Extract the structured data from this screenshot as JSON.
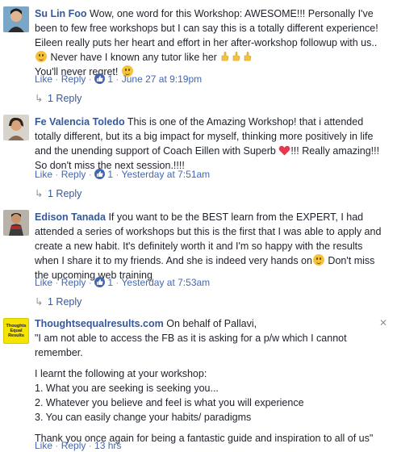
{
  "comments": [
    {
      "author": "Su Lin Foo",
      "text_1": " Wow, one word for this Workshop: AWESOME!!! Personally I've been to few free workshops but I can say this is a totally different experience! Eileen really puts her heart and effort in her after-workshop followup with us..",
      "text_2": " Never have I known any tutor like her",
      "text_3": "You'll never regret!",
      "like": "Like",
      "reply": "Reply",
      "like_count": "1",
      "time": "June 27 at 9:19pm",
      "replies": "1 Reply"
    },
    {
      "author": "Fe Valencia Toledo",
      "text_1": " This is one of the Amazing Workshop! that i attended totally different, but its a big impact for myself, thinking more positively in life and the unending support of Coach Eillen with Superb",
      "text_2": "!!! Really amazing!!! So don't miss the next session.!!!!",
      "like": "Like",
      "reply": "Reply",
      "like_count": "1",
      "time": "Yesterday at 7:51am",
      "replies": "1 Reply"
    },
    {
      "author": "Edison Tanada",
      "text_1": " If you want to be the BEST learn from the EXPERT, I had attended a series of workshops but this is the first that I was able to apply and create a new habit. It's definitely worth it and I'm so happy with the results when I share it to my friends. And she is indeed very hands on",
      "text_2": " Don't miss the upcoming web training",
      "like": "Like",
      "reply": "Reply",
      "like_count": "1",
      "time": "Yesterday at 7:53am",
      "replies": "1 Reply"
    },
    {
      "author": "Thoughtsequalresults.com",
      "avatar_text": "Thoughts Equal Results",
      "intro": " On behalf of Pallavi,",
      "line_1": "\"I am not able to access the FB as it is asking for a p/w which I cannot remember.",
      "line_2": "I learnt the following at your workshop:",
      "line_3": "1. What you are seeking is seeking you...",
      "line_4": "2. Whatever you believe and feel is what you will experience",
      "line_5": "3. You can easily change your habits/ paradigms",
      "line_6": "Thank you once again for being a fantastic guide and inspiration to all of us\"",
      "like": "Like",
      "reply": "Reply",
      "time": "13 hrs"
    }
  ],
  "colors": {
    "link": "#365899",
    "meta": "#90949c",
    "like_blue": "#4267b2",
    "avatar_yellow": "#f5e300"
  },
  "icons": [
    "smile-emoji",
    "pointing-hand-emoji",
    "heart-emoji",
    "thumbs-up-icon",
    "reply-arrow-icon",
    "close-icon"
  ]
}
